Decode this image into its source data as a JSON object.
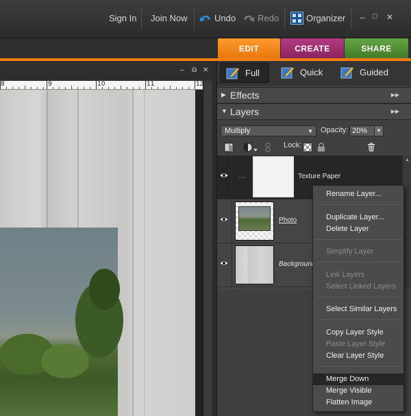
{
  "topbar": {
    "sign_in": "Sign In",
    "join_now": "Join Now",
    "undo": "Undo",
    "redo": "Redo",
    "organizer": "Organizer",
    "minimize": "–",
    "maximize": "□",
    "close": "✕"
  },
  "mode_tabs": [
    {
      "label": "EDIT",
      "color": "#f08213"
    },
    {
      "label": "CREATE",
      "color": "#9b2b6e"
    },
    {
      "label": "SHARE",
      "color": "#4e8a32"
    }
  ],
  "doc_window": {
    "minimize": "–",
    "restore": "⧉",
    "close": "✕",
    "ruler_numbers": [
      "8",
      "9",
      "10",
      "11",
      "12"
    ]
  },
  "edit_modes": {
    "full": "Full",
    "quick": "Quick",
    "guided": "Guided"
  },
  "panels": {
    "effects": "Effects",
    "layers": "Layers"
  },
  "layers_panel": {
    "blend_mode": "Multiply",
    "opacity_label": "Opacity:",
    "opacity_value": "20%",
    "lock_label": "Lock:",
    "layers": [
      {
        "name": "Texture Paper",
        "selected": true,
        "italic": false,
        "underline": false
      },
      {
        "name": "Photo",
        "selected": false,
        "italic": false,
        "underline": true
      },
      {
        "name": "Background",
        "selected": false,
        "italic": true,
        "underline": false
      }
    ]
  },
  "context_menu": {
    "items": [
      {
        "label": "Rename Layer...",
        "enabled": true
      },
      {
        "label": "Duplicate Layer...",
        "enabled": true
      },
      {
        "label": "Delete Layer",
        "enabled": true
      },
      {
        "label": "Simplify Layer",
        "enabled": false
      },
      {
        "label": "Link Layers",
        "enabled": false
      },
      {
        "label": "Select Linked Layers",
        "enabled": false
      },
      {
        "label": "Select Similar Layers",
        "enabled": true
      },
      {
        "label": "Copy Layer Style",
        "enabled": true
      },
      {
        "label": "Paste Layer Style",
        "enabled": false
      },
      {
        "label": "Clear Layer Style",
        "enabled": true
      },
      {
        "label": "Merge Down",
        "enabled": true,
        "highlighted": true
      },
      {
        "label": "Merge Visible",
        "enabled": true
      },
      {
        "label": "Flatten Image",
        "enabled": true
      }
    ]
  }
}
